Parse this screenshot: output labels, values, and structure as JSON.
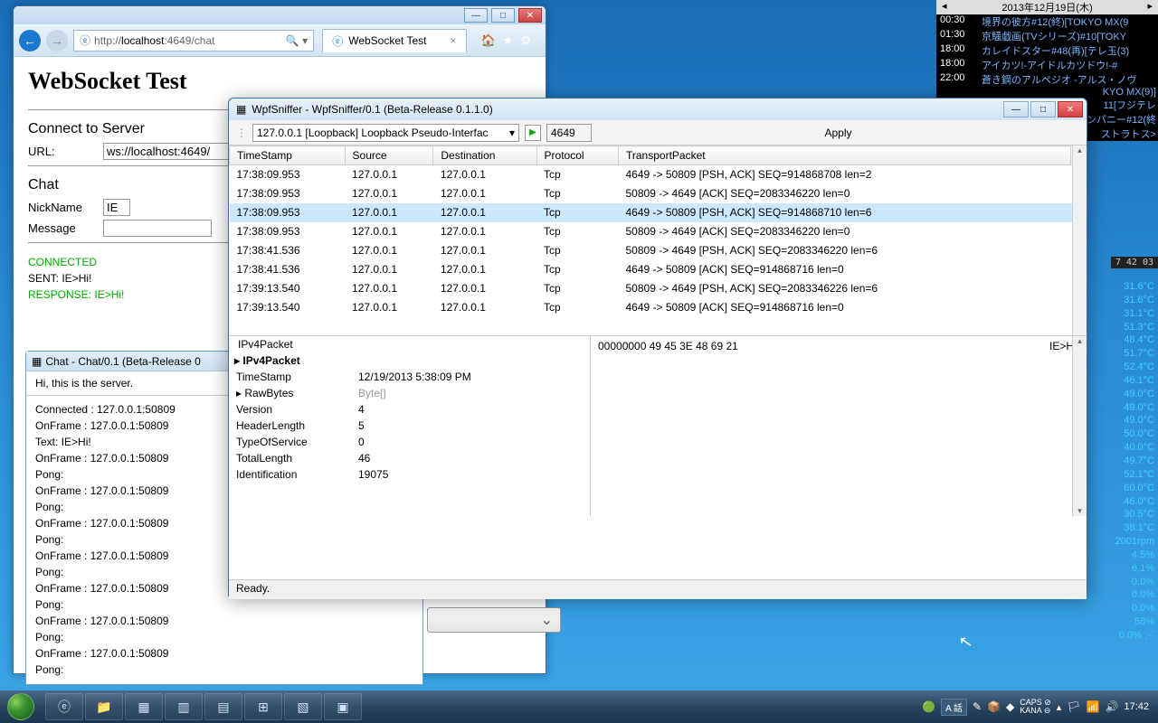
{
  "ie": {
    "url_proto": "http://",
    "url_host": "localhost",
    "url_port_path": ":4649/chat",
    "search_icon": "🔍",
    "tab_title": "WebSocket Test",
    "title": "WebSocket Test",
    "connect_h": "Connect to Server",
    "url_label": "URL:",
    "url_value": "ws://localhost:4649/",
    "chat_h": "Chat",
    "nick_label": "NickName",
    "nick_value": "IE",
    "msg_label": "Message",
    "stat1": "CONNECTED",
    "stat2": "SENT: IE>Hi!",
    "stat3": "RESPONSE: IE>Hi!"
  },
  "chat": {
    "title": "Chat - Chat/0.1 (Beta-Release 0",
    "top": "Hi, this is the server.",
    "lines": [
      "Connected : 127.0.0.1:50809",
      "OnFrame : 127.0.0.1:50809",
      "Text: IE>Hi!",
      "OnFrame : 127.0.0.1:50809",
      "Pong:",
      "OnFrame : 127.0.0.1:50809",
      "Pong:",
      "OnFrame : 127.0.0.1:50809",
      "Pong:",
      "OnFrame : 127.0.0.1:50809",
      "Pong:",
      "OnFrame : 127.0.0.1:50809",
      "Pong:",
      "OnFrame : 127.0.0.1:50809",
      "Pong:",
      "OnFrame : 127.0.0.1:50809",
      "Pong:"
    ]
  },
  "sniff": {
    "title": "WpfSniffer - WpfSniffer/0.1 (Beta-Release 0.1.1.0)",
    "combo": "127.0.0.1 [Loopback] Loopback Pseudo-Interfac",
    "port": "4649",
    "apply": "Apply",
    "cols": [
      "TimeStamp",
      "Source",
      "Destination",
      "Protocol",
      "TransportPacket"
    ],
    "rows": [
      {
        "ts": "17:38:09.953",
        "src": "127.0.0.1",
        "dst": "127.0.0.1",
        "proto": "Tcp",
        "pkt": "4649 -> 50809 [PSH, ACK]  SEQ=914868708  len=2"
      },
      {
        "ts": "17:38:09.953",
        "src": "127.0.0.1",
        "dst": "127.0.0.1",
        "proto": "Tcp",
        "pkt": "50809 -> 4649 [ACK]  SEQ=2083346220  len=0"
      },
      {
        "ts": "17:38:09.953",
        "src": "127.0.0.1",
        "dst": "127.0.0.1",
        "proto": "Tcp",
        "pkt": "4649 -> 50809 [PSH, ACK]  SEQ=914868710  len=6",
        "sel": true
      },
      {
        "ts": "17:38:09.953",
        "src": "127.0.0.1",
        "dst": "127.0.0.1",
        "proto": "Tcp",
        "pkt": "50809 -> 4649 [ACK]  SEQ=2083346220  len=0"
      },
      {
        "ts": "17:38:41.536",
        "src": "127.0.0.1",
        "dst": "127.0.0.1",
        "proto": "Tcp",
        "pkt": "50809 -> 4649 [PSH, ACK]  SEQ=2083346220  len=6"
      },
      {
        "ts": "17:38:41.536",
        "src": "127.0.0.1",
        "dst": "127.0.0.1",
        "proto": "Tcp",
        "pkt": "4649 -> 50809 [ACK]  SEQ=914868716  len=0"
      },
      {
        "ts": "17:39:13.540",
        "src": "127.0.0.1",
        "dst": "127.0.0.1",
        "proto": "Tcp",
        "pkt": "50809 -> 4649 [PSH, ACK]  SEQ=2083346226  len=6"
      },
      {
        "ts": "17:39:13.540",
        "src": "127.0.0.1",
        "dst": "127.0.0.1",
        "proto": "Tcp",
        "pkt": "4649 -> 50809 [ACK]  SEQ=914868716  len=0"
      }
    ],
    "det_hdr0": "IPv4Packet",
    "det_hdr": "▸ IPv4Packet",
    "det": [
      {
        "k": "TimeStamp",
        "v": "12/19/2013 5:38:09 PM"
      },
      {
        "k": "▸ RawBytes",
        "v": "Byte[]",
        "grey": true
      },
      {
        "k": "Version",
        "v": "4"
      },
      {
        "k": "HeaderLength",
        "v": "5"
      },
      {
        "k": "TypeOfService",
        "v": "0"
      },
      {
        "k": "TotalLength",
        "v": "46"
      },
      {
        "k": "Identification",
        "v": "19075"
      }
    ],
    "hex_off": "00000000  ",
    "hex_bytes": "49 45 3E 48 69 21",
    "hex_ascii": "IE>Hi!",
    "status": "Ready."
  },
  "overlay": {
    "date": "2013年12月19日(木)",
    "rows": [
      {
        "t": "00:30",
        "p": "境界の彼方#12(終)[TOKYO MX(9"
      },
      {
        "t": "01:30",
        "p": "京騒戯画(TVシリーズ)#10[TOKY"
      },
      {
        "t": "18:00",
        "p": "カレイドスター#48(再)[テレ玉(3)"
      },
      {
        "t": "18:00",
        "p": "アイカツ!-アイドルカツドウ!-#"
      },
      {
        "t": "22:00",
        "p": "蒼き鋼のアルペジオ -アルス・ノヴ"
      }
    ],
    "more": [
      "KYO MX(9)]",
      "11[フジテレ",
      "ンパニー#12(終",
      "ストラトス>"
    ]
  },
  "clockbar": "7 42 03",
  "temps": [
    "31.6°C",
    "31.6°C",
    "31.1°C",
    "51.3°C",
    "48.4°C",
    "51.7°C",
    "52.4°C",
    "46.1°C",
    "49.0°C",
    "49.0°C",
    "49.0°C",
    "50.0°C",
    "40.0°C",
    "49.7°C",
    "52.1°C",
    "60.0°C",
    "46.0°C",
    "30.5°C",
    "38.1°C",
    "2001rpm",
    "4.5%",
    "6.1%",
    "0.0%",
    "0.0%",
    "0.0%",
    "58%",
    "0.0%  ⋰"
  ],
  "taskbar": {
    "lang": "A 話",
    "caps": "CAPS",
    "kana": "KANA",
    "time": "17:42"
  }
}
